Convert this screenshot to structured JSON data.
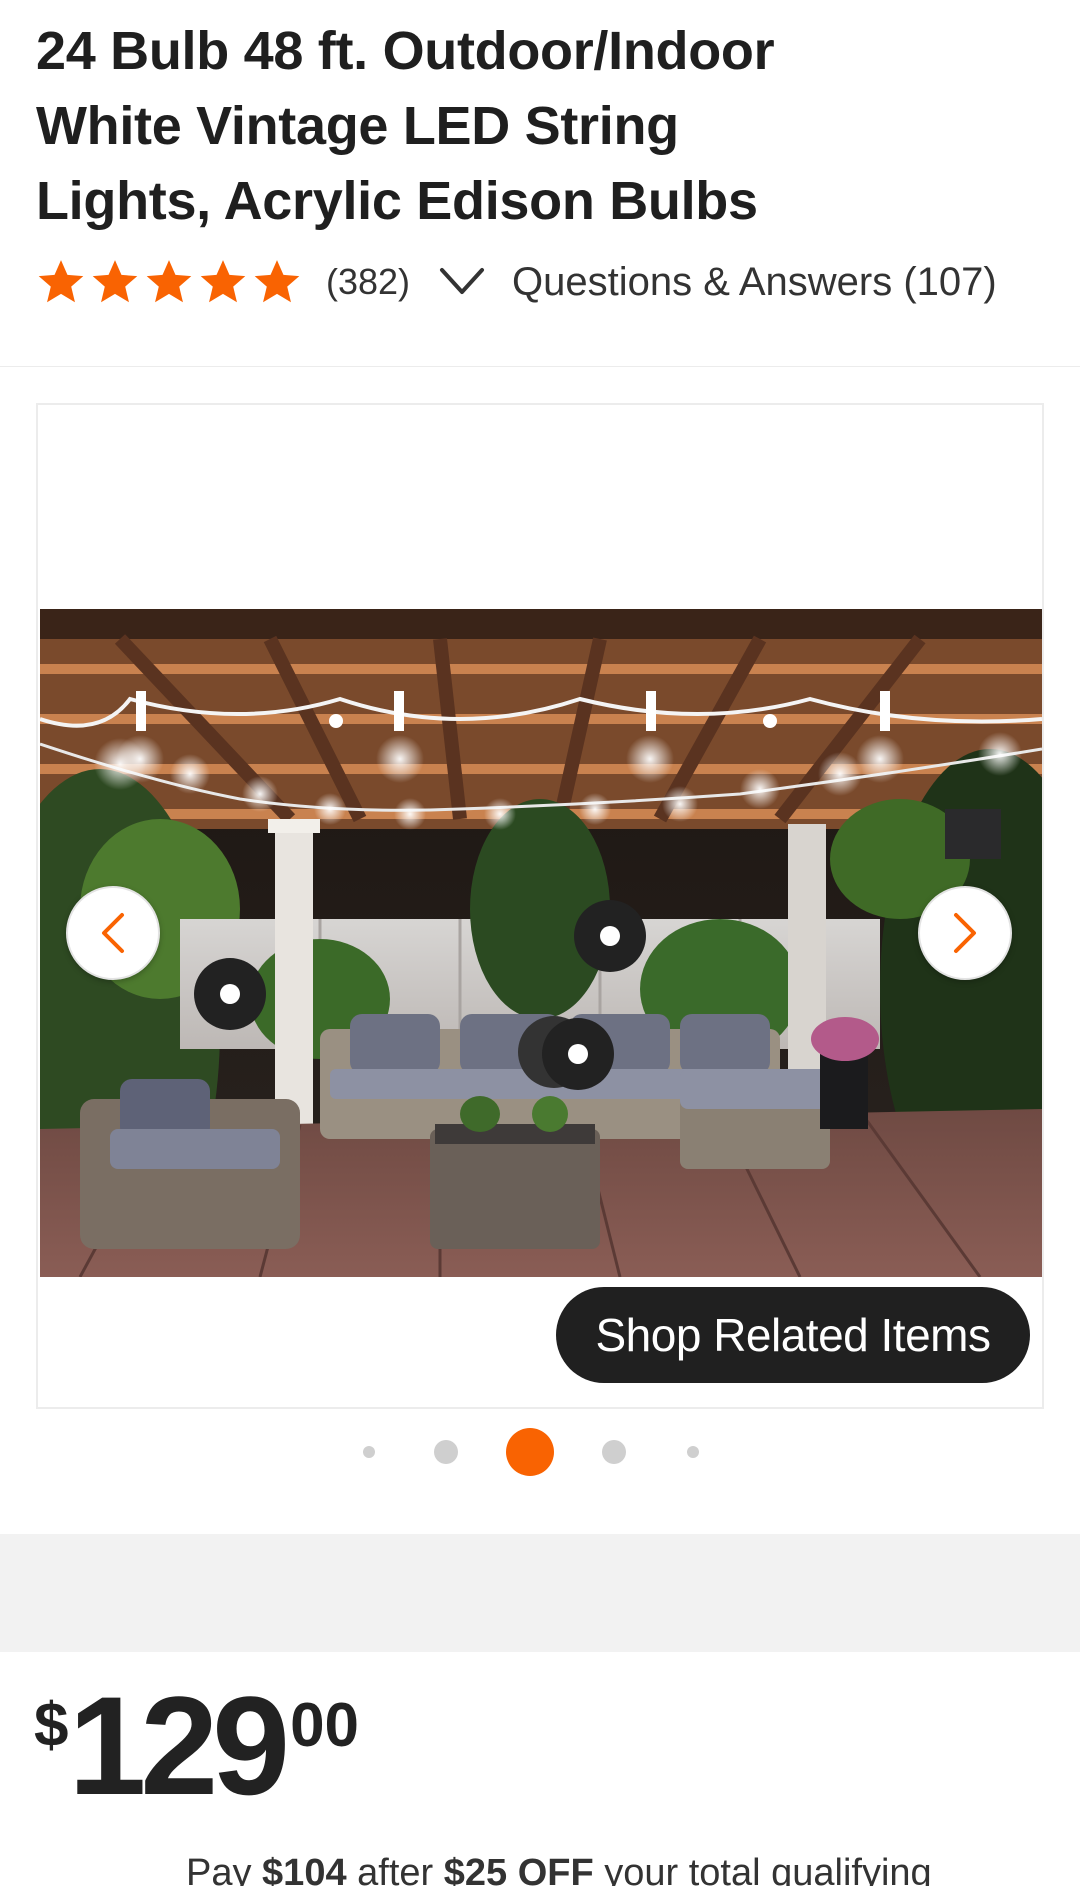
{
  "product": {
    "title_line1": "24 Bulb 48 ft. Outdoor/Indoor",
    "title_line2": "White Vintage LED String",
    "title_line3": "Lights, Acrylic Edison Bulbs",
    "review_count": "(382)",
    "questions_link": "Questions & Answers (107)",
    "rating": 5,
    "star_color": "#f96302"
  },
  "gallery": {
    "shop_related_label": "Shop Related Items",
    "image_name": "patio-string-lights-photo",
    "active_index": 2,
    "dot_count": 5,
    "accent_color": "#f96302"
  },
  "pricing": {
    "currency_symbol": "$",
    "whole": "129",
    "cents": "00",
    "promo_prefix": "Pay ",
    "promo_amount": "$104",
    "promo_mid": " after ",
    "promo_discount": "$25 OFF",
    "promo_suffix": " your total qualifying"
  }
}
